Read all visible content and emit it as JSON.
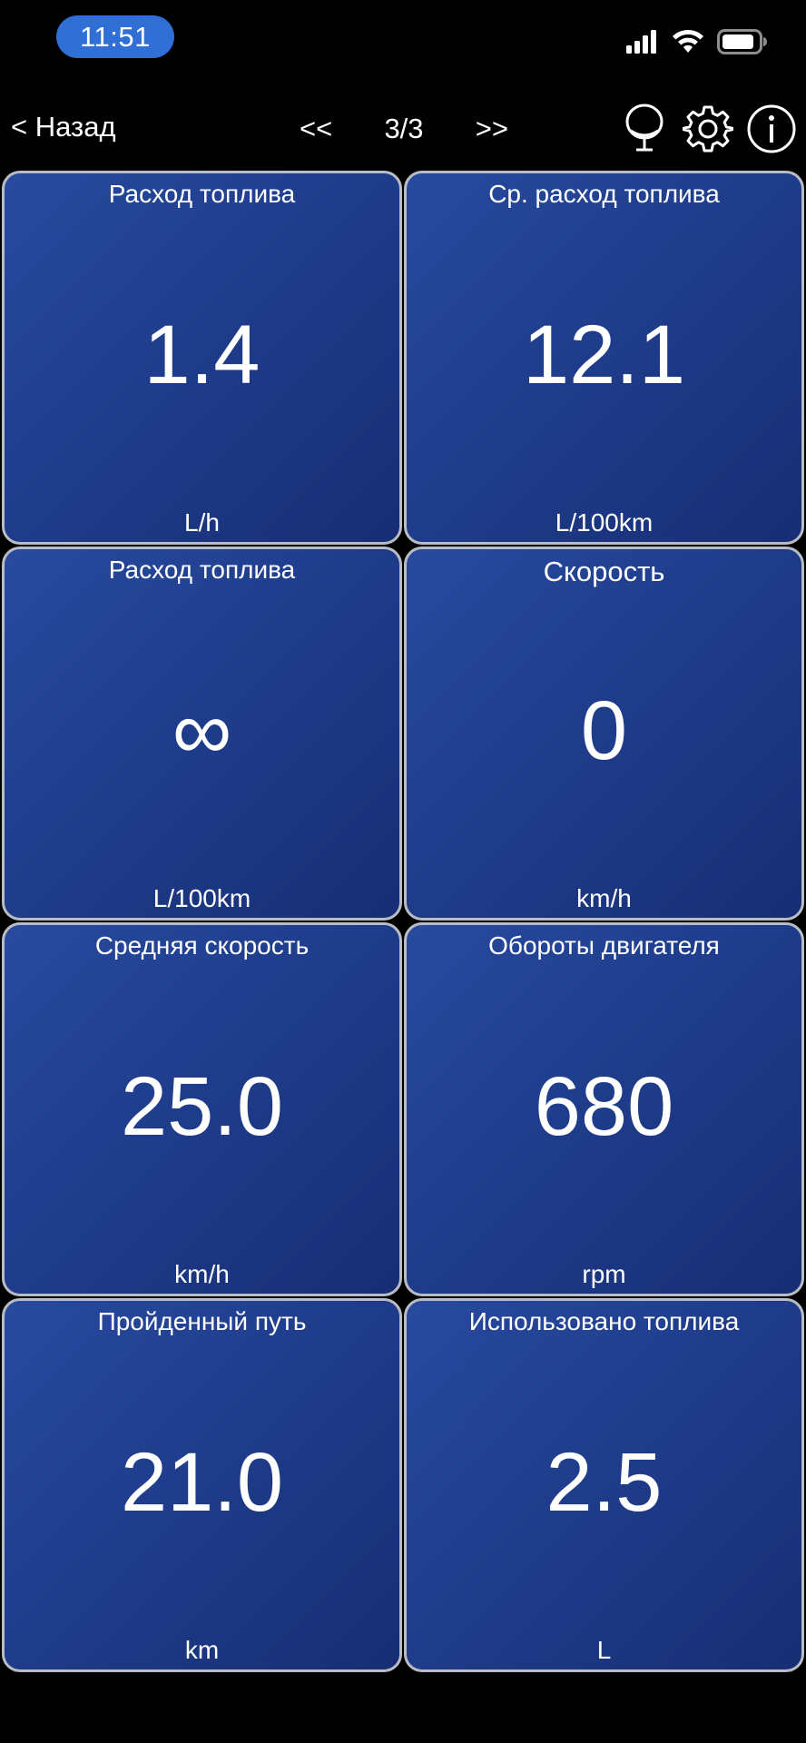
{
  "status_bar": {
    "time": "11:51",
    "icons": [
      "cellular-signal-icon",
      "wifi-icon",
      "battery-icon"
    ]
  },
  "nav": {
    "back_label": "< Назад",
    "prev_label": "<<",
    "page_indicator": "3/3",
    "next_label": ">>",
    "icons": [
      "microphone-icon",
      "gear-icon",
      "info-icon"
    ]
  },
  "colors": {
    "time_pill": "#2f6fd6",
    "tile_bg_start": "#284a9e",
    "tile_bg_end": "#172e74",
    "tile_border": "#b9bcc4"
  },
  "tiles": [
    {
      "title": "Расход топлива",
      "value": "1.4",
      "unit": "L/h"
    },
    {
      "title": "Ср. расход топлива",
      "value": "12.1",
      "unit": "L/100km"
    },
    {
      "title": "Расход топлива",
      "value": "∞",
      "unit": "L/100km"
    },
    {
      "title": "Скорость",
      "value": "0",
      "unit": "km/h"
    },
    {
      "title": "Средняя скорость",
      "value": "25.0",
      "unit": "km/h"
    },
    {
      "title": "Обороты двигателя",
      "value": "680",
      "unit": "rpm"
    },
    {
      "title": "Пройденный путь",
      "value": "21.0",
      "unit": "km"
    },
    {
      "title": "Использовано топлива",
      "value": "2.5",
      "unit": "L"
    }
  ]
}
